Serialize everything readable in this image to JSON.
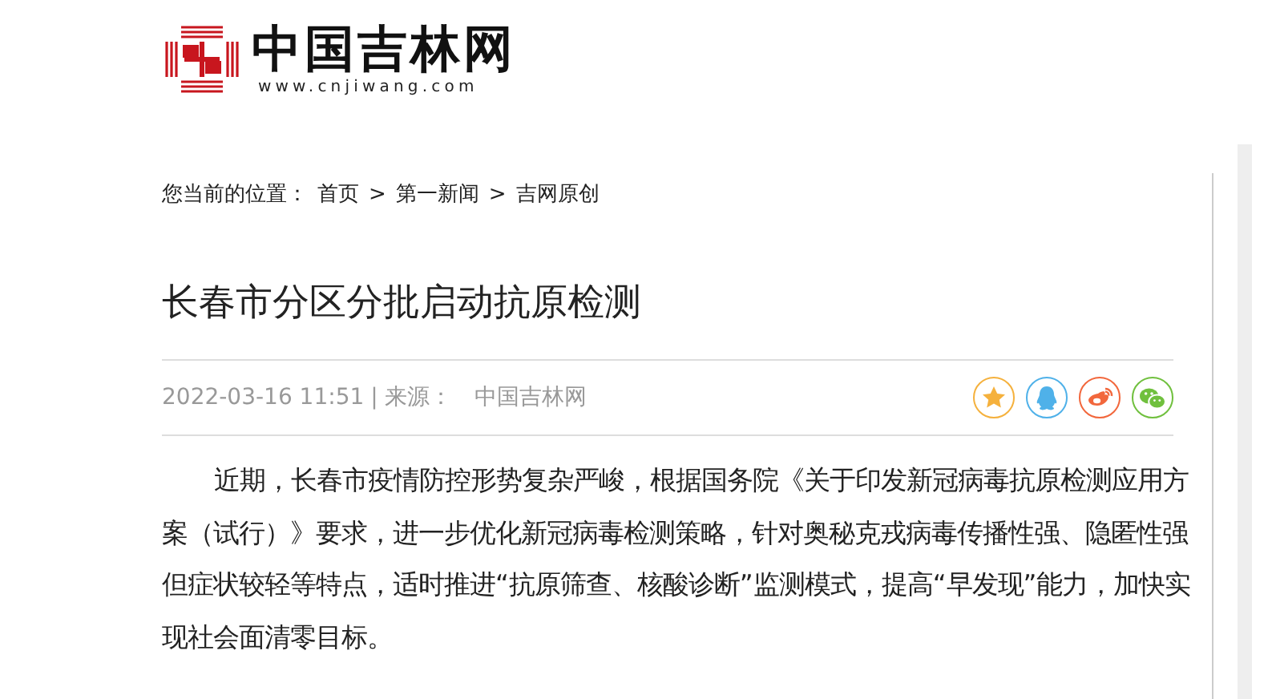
{
  "logo": {
    "name": "中国吉林网",
    "url": "www.cnjiwang.com"
  },
  "breadcrumb": {
    "label": "您当前的位置：",
    "items": [
      "首页",
      "第一新闻",
      "吉网原创"
    ],
    "separator": ">"
  },
  "article": {
    "title": "长春市分区分批启动抗原检测",
    "date": "2022-03-16 11:51",
    "divider": "|",
    "source_label": "来源：",
    "source": "中国吉林网",
    "share": [
      {
        "kind": "favorite",
        "color": "#f5b13d"
      },
      {
        "kind": "qq",
        "color": "#4fb1e9"
      },
      {
        "kind": "weibo",
        "color": "#f2673c"
      },
      {
        "kind": "wechat",
        "color": "#70c03e"
      }
    ],
    "body": "近期，长春市疫情防控形势复杂严峻，根据国务院《关于印发新冠病毒抗原检测应用方案（试行）》要求，进一步优化新冠病毒检测策略，针对奥秘克戎病毒传播性强、隐匿性强但症状较轻等特点，适时推进“抗原筛查、核酸诊断”监测模式，提高“早发现”能力，加快实现社会面清零目标。"
  }
}
